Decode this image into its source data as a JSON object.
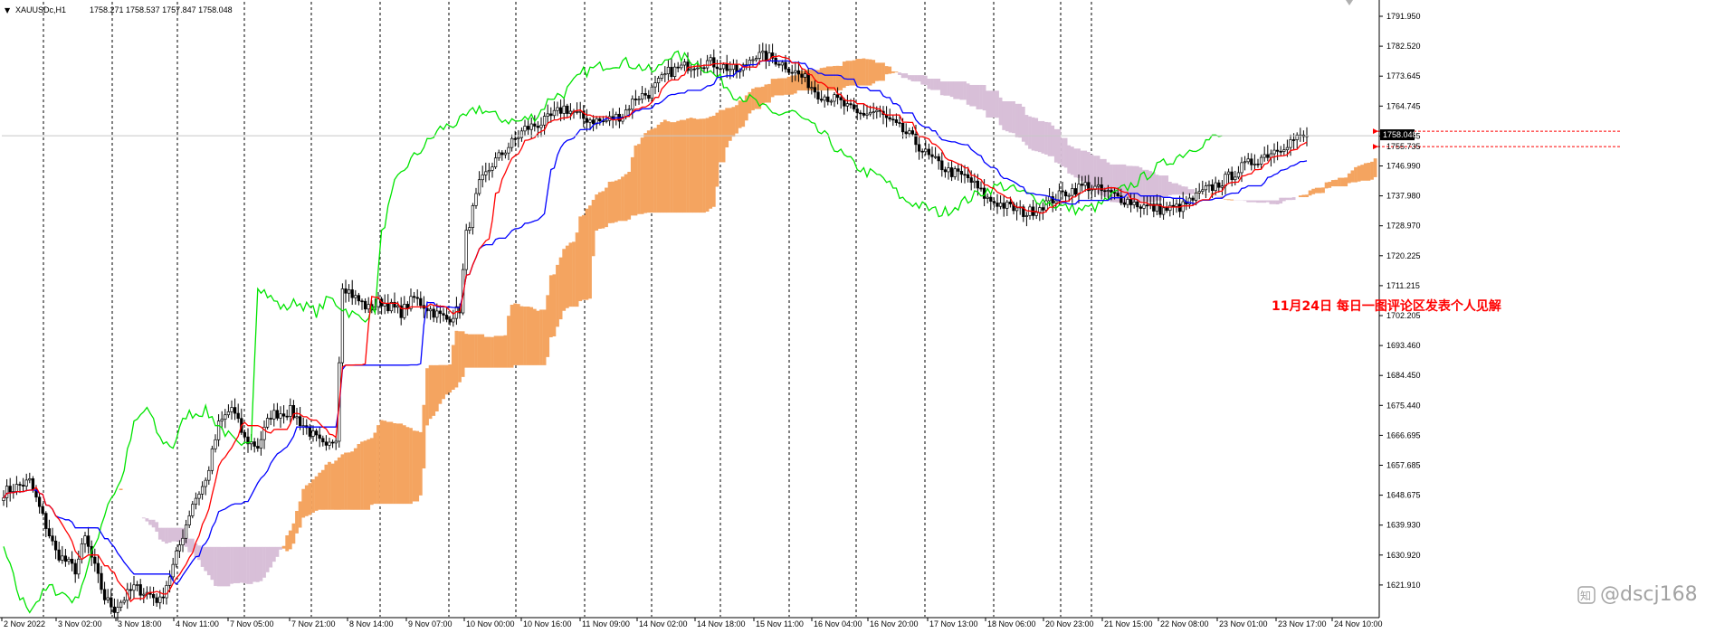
{
  "header": {
    "menu_glyph": "▼",
    "symbol": "XAUUSDc,H1",
    "ohlc": "1758.271 1758.537 1757.847 1758.048"
  },
  "annotation_text": "11月24日 每日一图评论区发表个人见解",
  "watermark": {
    "logo_glyph": "知",
    "handle": "@dscj168"
  },
  "price_labels": {
    "current": "1758.048",
    "reference": "1755.735"
  },
  "colors": {
    "background": "#ffffff",
    "candles": "#000000",
    "tenkan": "#ff0000",
    "kijun": "#0000ff",
    "chikou": "#00e400",
    "kumo_bull": "#f4a460",
    "kumo_bear": "#d8bfd8",
    "period_separator": "#000000",
    "annotation": "#ff0000",
    "axis_text": "#000000",
    "current_price_box": "#000000",
    "current_price_text": "#ffffff"
  },
  "chart_data": {
    "type": "candlestick",
    "title": "XAUUSDc,H1",
    "indicators": [
      "Ichimoku Kinko Hyo"
    ],
    "ylim": [
      1621.7,
      1796.0
    ],
    "y_ticks": [
      "1791.950",
      "1782.520",
      "1773.645",
      "1764.745",
      "1755.735",
      "1746.990",
      "1737.980",
      "1728.970",
      "1720.225",
      "1711.215",
      "1702.205",
      "1693.460",
      "1684.450",
      "1675.440",
      "1666.695",
      "1657.685",
      "1648.675",
      "1639.930",
      "1630.920",
      "1621.910"
    ],
    "x_ticks": [
      "2 Nov 2022",
      "3 Nov 02:00",
      "3 Nov 18:00",
      "4 Nov 11:00",
      "7 Nov 05:00",
      "7 Nov 21:00",
      "8 Nov 14:00",
      "9 Nov 07:00",
      "10 Nov 00:00",
      "10 Nov 16:00",
      "11 Nov 09:00",
      "14 Nov 02:00",
      "14 Nov 18:00",
      "15 Nov 11:00",
      "16 Nov 04:00",
      "16 Nov 20:00",
      "17 Nov 13:00",
      "18 Nov 06:00",
      "20 Nov 23:00",
      "21 Nov 15:00",
      "22 Nov 08:00",
      "23 Nov 01:00",
      "23 Nov 17:00",
      "24 Nov 10:00"
    ],
    "current_price": 1758.048,
    "price_levels": [
      1758.048,
      1755.735
    ],
    "price_path": [
      [
        0,
        1657
      ],
      [
        8,
        1660
      ],
      [
        14,
        1645
      ],
      [
        16,
        1640
      ],
      [
        22,
        1635
      ],
      [
        25,
        1644
      ],
      [
        31,
        1627
      ],
      [
        34,
        1624
      ],
      [
        40,
        1630
      ],
      [
        45,
        1628
      ],
      [
        48,
        1626
      ],
      [
        52,
        1636
      ],
      [
        58,
        1654
      ],
      [
        62,
        1660
      ],
      [
        66,
        1676
      ],
      [
        70,
        1681
      ],
      [
        74,
        1672
      ],
      [
        78,
        1670
      ],
      [
        82,
        1679
      ],
      [
        88,
        1680
      ],
      [
        92,
        1676
      ],
      [
        96,
        1672
      ],
      [
        99,
        1669
      ],
      [
        102,
        1673
      ],
      [
        104,
        1716
      ],
      [
        108,
        1712
      ],
      [
        112,
        1709
      ],
      [
        116,
        1711
      ],
      [
        122,
        1708
      ],
      [
        126,
        1712
      ],
      [
        132,
        1708
      ],
      [
        136,
        1706
      ],
      [
        140,
        1709
      ],
      [
        142,
        1730
      ],
      [
        146,
        1744
      ],
      [
        150,
        1750
      ],
      [
        156,
        1756
      ],
      [
        160,
        1760
      ],
      [
        166,
        1762
      ],
      [
        172,
        1766
      ],
      [
        178,
        1763
      ],
      [
        184,
        1762
      ],
      [
        190,
        1764
      ],
      [
        194,
        1769
      ],
      [
        198,
        1770
      ],
      [
        204,
        1776
      ],
      [
        210,
        1778
      ],
      [
        216,
        1779
      ],
      [
        220,
        1778
      ],
      [
        226,
        1776
      ],
      [
        230,
        1781
      ],
      [
        236,
        1780
      ],
      [
        240,
        1778
      ],
      [
        246,
        1774
      ],
      [
        250,
        1770
      ],
      [
        256,
        1768
      ],
      [
        262,
        1764
      ],
      [
        268,
        1765
      ],
      [
        272,
        1762
      ],
      [
        278,
        1758
      ],
      [
        284,
        1752
      ],
      [
        290,
        1748
      ],
      [
        296,
        1746
      ],
      [
        302,
        1740
      ],
      [
        308,
        1738
      ],
      [
        314,
        1736
      ],
      [
        320,
        1739
      ],
      [
        326,
        1742
      ],
      [
        332,
        1744
      ],
      [
        338,
        1742
      ],
      [
        344,
        1740
      ],
      [
        350,
        1738
      ],
      [
        356,
        1737
      ],
      [
        362,
        1738
      ],
      [
        368,
        1742
      ],
      [
        374,
        1745
      ],
      [
        380,
        1749
      ],
      [
        386,
        1752
      ],
      [
        392,
        1755
      ],
      [
        396,
        1757
      ],
      [
        400,
        1758.048
      ]
    ]
  }
}
